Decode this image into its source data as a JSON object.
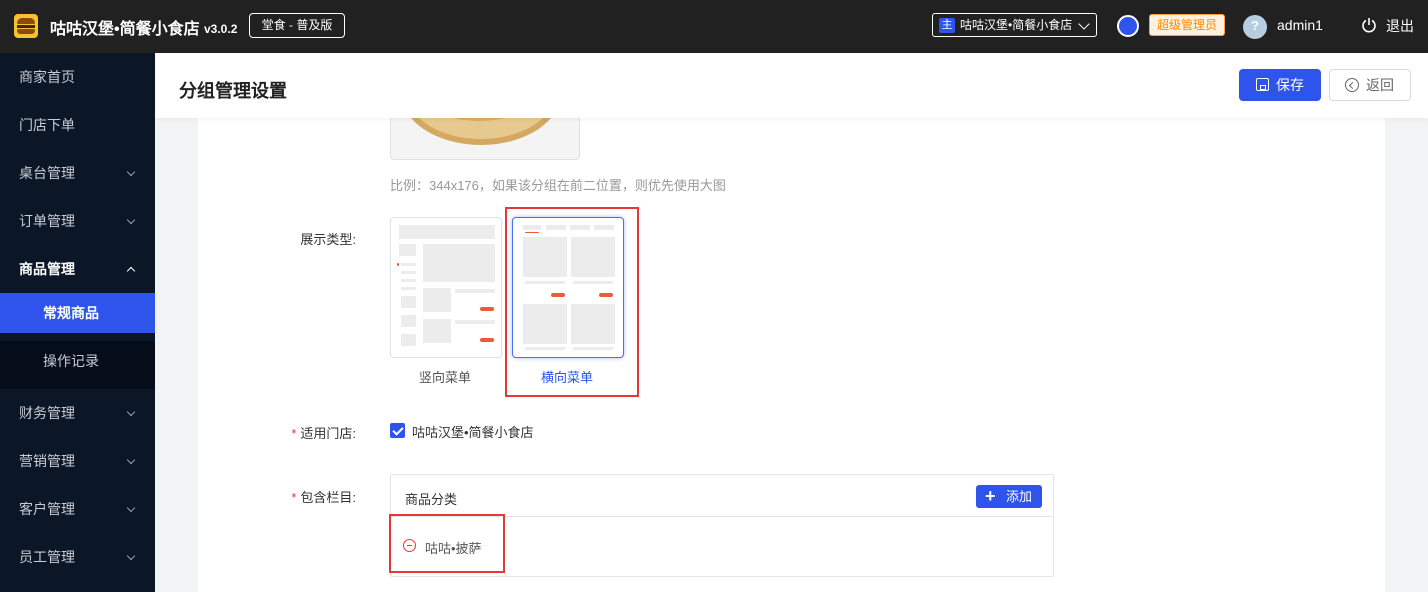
{
  "topbar": {
    "brand": "咕咕汉堡•简餐小食店",
    "version": "v3.0.2",
    "edition": "堂食 - 普及版",
    "store_tag": "主",
    "store_name": "咕咕汉堡•简餐小食店",
    "role": "超级管理员",
    "username": "admin1",
    "logout": "退出"
  },
  "sidebar": {
    "items": [
      {
        "label": "商家首页"
      },
      {
        "label": "门店下单"
      },
      {
        "label": "桌台管理"
      },
      {
        "label": "订单管理"
      },
      {
        "label": "商品管理"
      },
      {
        "label": "财务管理"
      },
      {
        "label": "营销管理"
      },
      {
        "label": "客户管理"
      },
      {
        "label": "员工管理"
      }
    ],
    "sub_items": [
      {
        "label": "常规商品"
      },
      {
        "label": "操作记录"
      }
    ]
  },
  "header": {
    "title": "分组管理设置",
    "save": "保存",
    "back": "返回"
  },
  "form": {
    "ratio_hint": "比例：344x176，如果该分组在前二位置，则优先使用大图",
    "display_type_label": "展示类型:",
    "vertical_menu": "竖向菜单",
    "horizontal_menu": "横向菜单",
    "required_mark": "*",
    "store_label": "适用门店:",
    "store_option": "咕咕汉堡•简餐小食店",
    "columns_label": "包含栏目:",
    "columns_header": "商品分类",
    "add": "添加",
    "category_item": "咕咕•披萨"
  },
  "colors": {
    "accent": "#2f54eb",
    "sidebar_bg": "#0b1627",
    "topbar_bg": "#212121",
    "highlight": "#e53935"
  }
}
